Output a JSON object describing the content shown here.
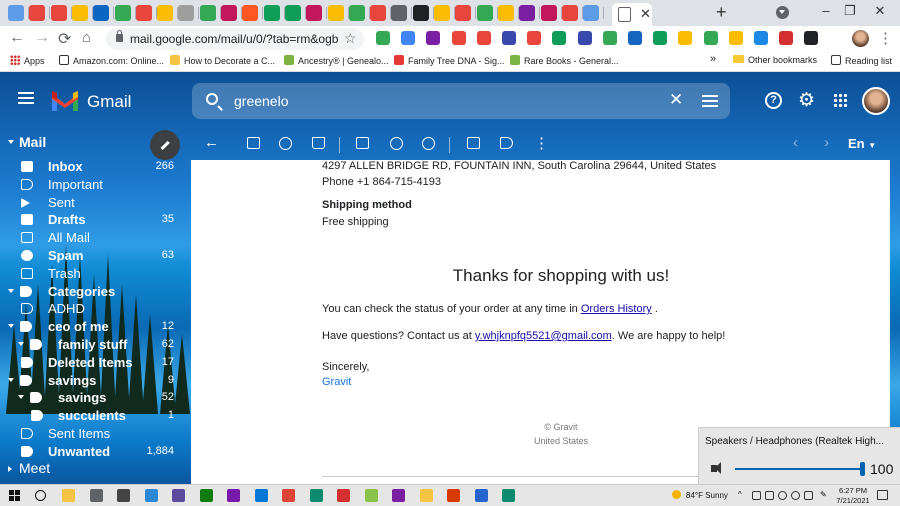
{
  "browser": {
    "url": "mail.google.com/mail/u/0/?tab=rm&ogbl...",
    "tab_close": "✕",
    "new_tab": "+",
    "window_buttons": [
      "–",
      "❐",
      "✕"
    ]
  },
  "bookmarks": [
    {
      "label": "Apps",
      "icon": "apps-grid-icon"
    },
    {
      "label": "Amazon.com: Online...",
      "icon": "amazon-icon"
    },
    {
      "label": "How to Decorate a C...",
      "icon": "bookmark-icon"
    },
    {
      "label": "Ancestry® | Genealo...",
      "icon": "ancestry-leaf-icon"
    },
    {
      "label": "Family Tree DNA - Sig...",
      "icon": "ftdna-icon"
    },
    {
      "label": "Rare Books - General...",
      "icon": "ancestry-leaf-icon"
    },
    {
      "label": "»",
      "icon": ""
    },
    {
      "label": "Other bookmarks",
      "icon": "folder-icon"
    },
    {
      "label": "Reading list",
      "icon": "reading-list-icon"
    }
  ],
  "gmail": {
    "logo_text": "Gmail",
    "search_value": "greenelo"
  },
  "sidebar": {
    "section": "Mail",
    "meet": "Meet",
    "items": [
      {
        "label": "Inbox",
        "count": "266",
        "bold": true
      },
      {
        "label": "Important",
        "count": "",
        "bold": false
      },
      {
        "label": "Sent",
        "count": "",
        "bold": false
      },
      {
        "label": "Drafts",
        "count": "35",
        "bold": true
      },
      {
        "label": "All Mail",
        "count": "",
        "bold": false
      },
      {
        "label": "Spam",
        "count": "63",
        "bold": true
      },
      {
        "label": "Trash",
        "count": "",
        "bold": false
      },
      {
        "label": "Categories",
        "count": "",
        "bold": true
      },
      {
        "label": "ADHD",
        "count": "",
        "bold": false
      },
      {
        "label": "ceo of me",
        "count": "12",
        "bold": true
      },
      {
        "label": "family stuff",
        "count": "62",
        "bold": true
      },
      {
        "label": "Deleted Items",
        "count": "17",
        "bold": true
      },
      {
        "label": "savings",
        "count": "9",
        "bold": true
      },
      {
        "label": "savings",
        "count": "52",
        "bold": true
      },
      {
        "label": "succulents",
        "count": "1",
        "bold": true
      },
      {
        "label": "Sent Items",
        "count": "",
        "bold": false
      },
      {
        "label": "Unwanted",
        "count": "1,884",
        "bold": true
      }
    ]
  },
  "toolbar": {
    "language": "En"
  },
  "message": {
    "address": "4297 ALLEN BRIDGE RD, FOUNTAIN INN, South Carolina 29644, United States",
    "phone": "Phone +1 864-715-4193",
    "shipping_method_label": "Shipping method",
    "shipping_method_value": "Free shipping",
    "thanks": "Thanks for shopping with us!",
    "status_prefix": "You can check the status of your order at any time in",
    "orders_link": "Orders History",
    "status_suffix": ".",
    "questions_prefix": "Have questions? Contact us at",
    "contact_email": "y.whjknpfq5521@gmail.com",
    "questions_suffix": ". We are happy to help!",
    "sincerely": "Sincerely,",
    "signature": "Gravit",
    "footer_copyright": "© Gravit",
    "footer_country": "United States"
  },
  "volume": {
    "device": "Speakers / Headphones (Realtek High...",
    "level": 100,
    "level_text": "100"
  },
  "taskbar": {
    "weather": "84°F  Sunny",
    "time": "6:27 PM",
    "date": "7/21/2021"
  }
}
